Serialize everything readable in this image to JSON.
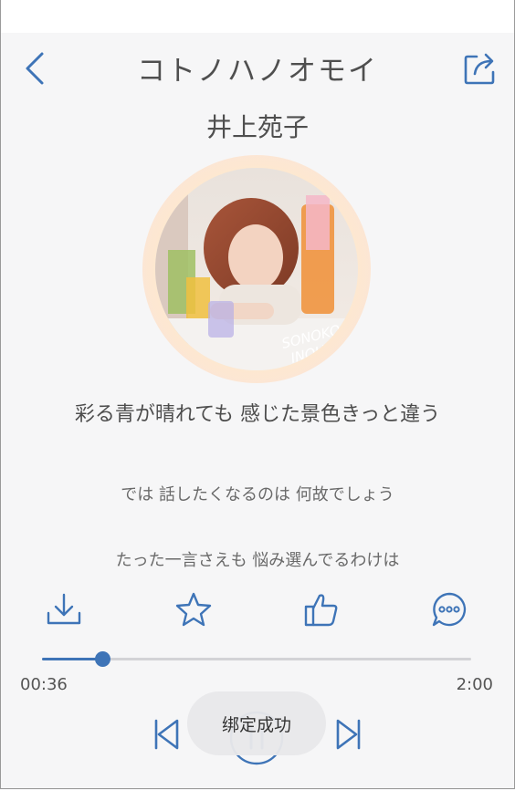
{
  "song": {
    "title": "コトノハノオモイ",
    "artist": "井上苑子"
  },
  "cover": {
    "art_text": [
      "SONOKO",
      "INOUE"
    ]
  },
  "lyrics": {
    "current": "彩る青が晴れても 感じた景色きっと違う",
    "line2": "では 話したくなるのは 何故でしょう",
    "line3": "たった一言さえも 悩み選んでるわけは"
  },
  "actions": [
    "download-icon",
    "star-icon",
    "thumbs-up-icon",
    "comment-icon"
  ],
  "player": {
    "elapsed": "00:36",
    "duration": "2:00",
    "progress_fraction": 0.14,
    "state": "playing"
  },
  "toast": {
    "message": "绑定成功"
  },
  "colors": {
    "accent": "#3e74b7",
    "background": "#f6f6f7",
    "text": "#4f4f4f"
  }
}
